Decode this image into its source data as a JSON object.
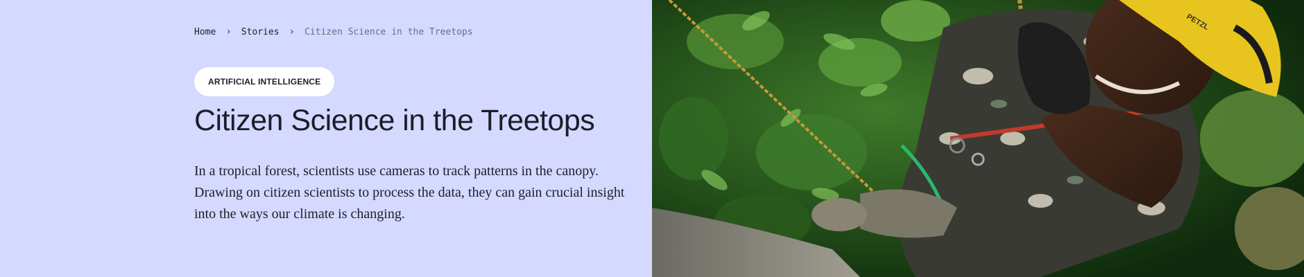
{
  "breadcrumb": {
    "home": "Home",
    "stories": "Stories",
    "current": "Citizen Science in the Treetops",
    "separator": "›"
  },
  "tag": {
    "label": "ARTIFICIAL INTELLIGENCE"
  },
  "title": "Citizen Science in the Treetops",
  "description": "In a tropical forest, scientists use cameras to track patterns in the canopy. Drawing on citizen scientists to process the data, they can gain crucial insight into the ways our climate is changing.",
  "hero_image": {
    "subject": "climber-in-canopy",
    "helmet_text": "PETZL"
  },
  "colors": {
    "panel_bg": "#d5d9ff",
    "text": "#1d1d2b",
    "muted": "#6a6d80",
    "tag_bg": "#ffffff"
  }
}
